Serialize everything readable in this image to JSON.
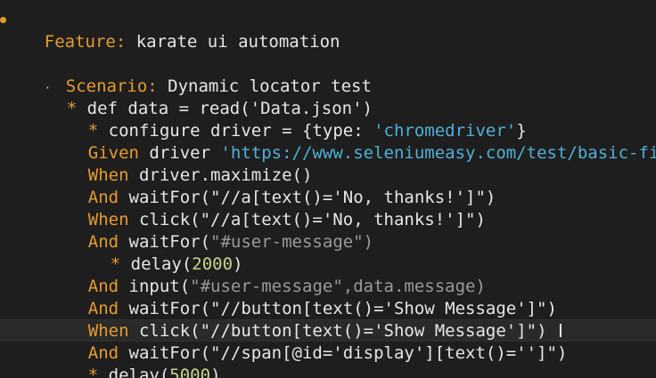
{
  "lines": [
    {
      "kw": "Feature:",
      "rest": " karate ui automation"
    },
    {
      "kw": "Scenario:",
      "rest": " Dynamic locator test"
    },
    {
      "star": "*",
      "rest": " def data = read('Data.json')"
    },
    {
      "star": "*",
      "rest_a": " configure driver = {type: ",
      "str": "'chromedriver'",
      "rest_b": "}"
    },
    {
      "kw": "Given",
      "rest": " driver ",
      "str": "'https://www.seleniumeasy.com/test/basic-fi"
    },
    {
      "kw": "When",
      "rest": " driver.maximize()"
    },
    {
      "kw": "And",
      "rest": " waitFor(\"//a[text()='No, thanks!']\")"
    },
    {
      "kw": "When",
      "rest": " click(\"//a[text()='No, thanks!']\")"
    },
    {
      "kw": "And",
      "rest": " waitFor(",
      "dim": "\"#user-message\")"
    },
    {
      "star": "*",
      "rest": " delay(",
      "num": "2000",
      "rest_b": ")"
    },
    {
      "kw": "And",
      "rest": " input(",
      "dim": "\"#user-message\",data.message)"
    },
    {
      "kw": "And",
      "rest": " waitFor(\"//button[text()='Show Message']\")"
    },
    {
      "kw": "When",
      "rest": " click(\"//button[text()='Show Message']\")"
    },
    {
      "kw": "And",
      "rest": " waitFor(\"//span[@id='display'][text()='']\")"
    },
    {
      "star": "*",
      "rest": " delay(",
      "num": "5000",
      "rest_b": ")"
    }
  ],
  "colors": {
    "background": "#1e1e1e",
    "keyword": "#e59b2f",
    "text": "#e6e6e6",
    "string": "#4fb0d8",
    "dim": "#9a9a9a",
    "number": "#c3d78b"
  }
}
